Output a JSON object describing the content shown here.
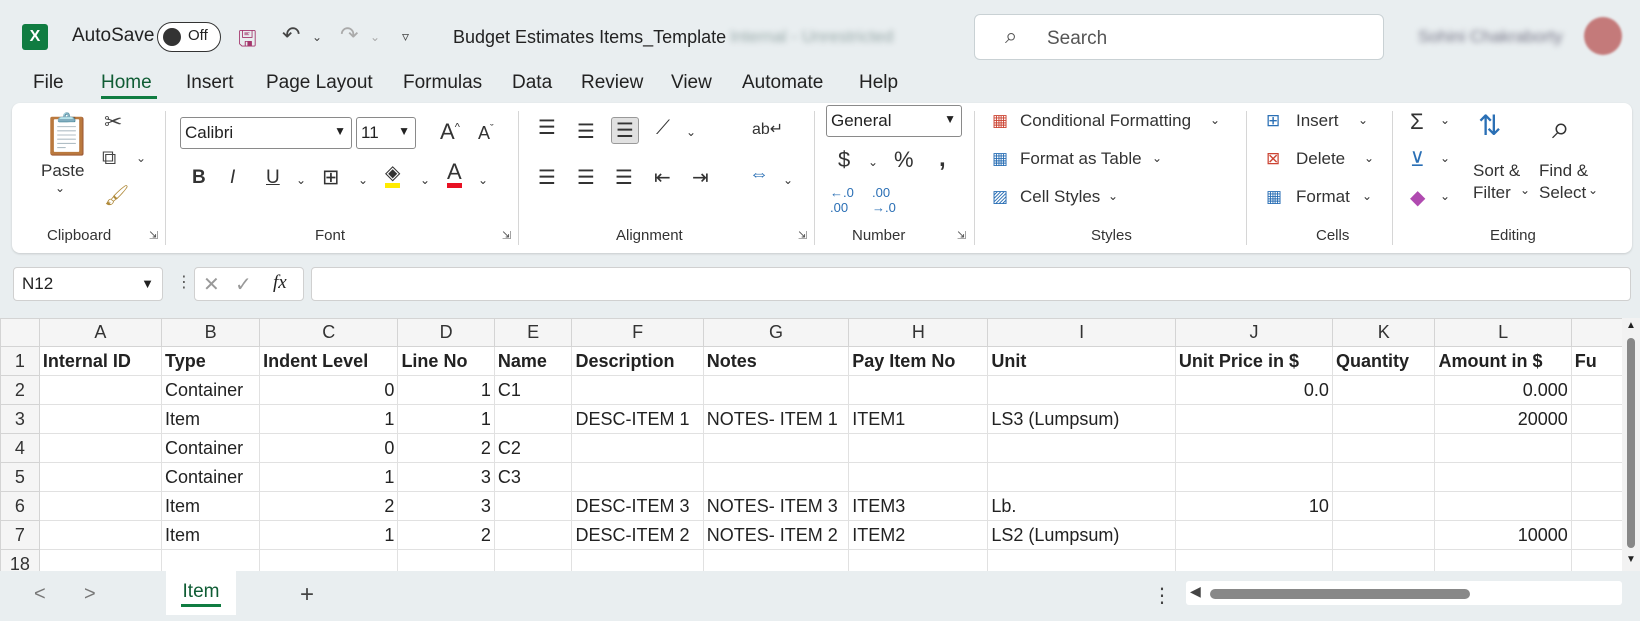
{
  "titlebar": {
    "app_icon": "X",
    "autosave_label": "AutoSave",
    "autosave_state": "Off",
    "doc_title": "Budget Estimates Items_Template",
    "sensitivity": "Internal - Unrestricted",
    "search_placeholder": "Search",
    "user_name": "Sohini Chakraborty"
  },
  "menu": [
    "File",
    "Home",
    "Insert",
    "Page Layout",
    "Formulas",
    "Data",
    "Review",
    "View",
    "Automate",
    "Help"
  ],
  "ribbon": {
    "clipboard": {
      "paste": "Paste",
      "label": "Clipboard"
    },
    "font": {
      "family": "Calibri",
      "size": "11",
      "label": "Font"
    },
    "alignment": {
      "label": "Alignment"
    },
    "number": {
      "format": "General",
      "label": "Number"
    },
    "styles": {
      "conditional": "Conditional Formatting",
      "format_table": "Format as Table",
      "cell_styles": "Cell Styles",
      "label": "Styles"
    },
    "cells": {
      "insert": "Insert",
      "delete": "Delete",
      "format": "Format",
      "label": "Cells"
    },
    "editing": {
      "sort": "Sort &",
      "filter": "Filter",
      "find": "Find &",
      "select": "Select",
      "label": "Editing"
    }
  },
  "formula_bar": {
    "name_box": "N12",
    "formula": ""
  },
  "grid": {
    "columns": [
      "A",
      "B",
      "C",
      "D",
      "E",
      "F",
      "G",
      "H",
      "I",
      "J",
      "K",
      "L"
    ],
    "rows": [
      {
        "n": "1",
        "cells": [
          "Internal ID",
          "Type",
          "Indent Level",
          "Line No",
          "Name",
          "Description",
          "Notes",
          "Pay Item No",
          "Unit",
          "Unit Price in $",
          "Quantity",
          "Amount in $",
          "Fu"
        ]
      },
      {
        "n": "2",
        "cells": [
          "",
          "Container",
          "0",
          "1",
          "C1",
          "",
          "",
          "",
          "",
          "0.0",
          "",
          "0.000",
          ""
        ]
      },
      {
        "n": "3",
        "cells": [
          "",
          "Item",
          "1",
          "1",
          "",
          "DESC-ITEM 1",
          "NOTES- ITEM 1",
          "ITEM1",
          "LS3 (Lumpsum)",
          "",
          "",
          "20000",
          ""
        ]
      },
      {
        "n": "4",
        "cells": [
          "",
          "Container",
          "0",
          "2",
          "C2",
          "",
          "",
          "",
          "",
          "",
          "",
          "",
          ""
        ]
      },
      {
        "n": "5",
        "cells": [
          "",
          "Container",
          "1",
          "3",
          "C3",
          "",
          "",
          "",
          "",
          "",
          "",
          "",
          ""
        ]
      },
      {
        "n": "6",
        "cells": [
          "",
          "Item",
          "2",
          "3",
          "",
          "DESC-ITEM 3",
          "NOTES- ITEM 3",
          "ITEM3",
          "Lb.",
          "10",
          "",
          "",
          ""
        ]
      },
      {
        "n": "7",
        "cells": [
          "",
          "Item",
          "1",
          "2",
          "",
          "DESC-ITEM 2",
          "NOTES- ITEM 2",
          "ITEM2",
          "LS2 (Lumpsum)",
          "",
          "",
          "10000",
          ""
        ]
      },
      {
        "n": "18",
        "cells": [
          "",
          "",
          "",
          "",
          "",
          "",
          "",
          "",
          "",
          "",
          "",
          "",
          ""
        ]
      }
    ]
  },
  "sheets": {
    "active": "Item"
  }
}
